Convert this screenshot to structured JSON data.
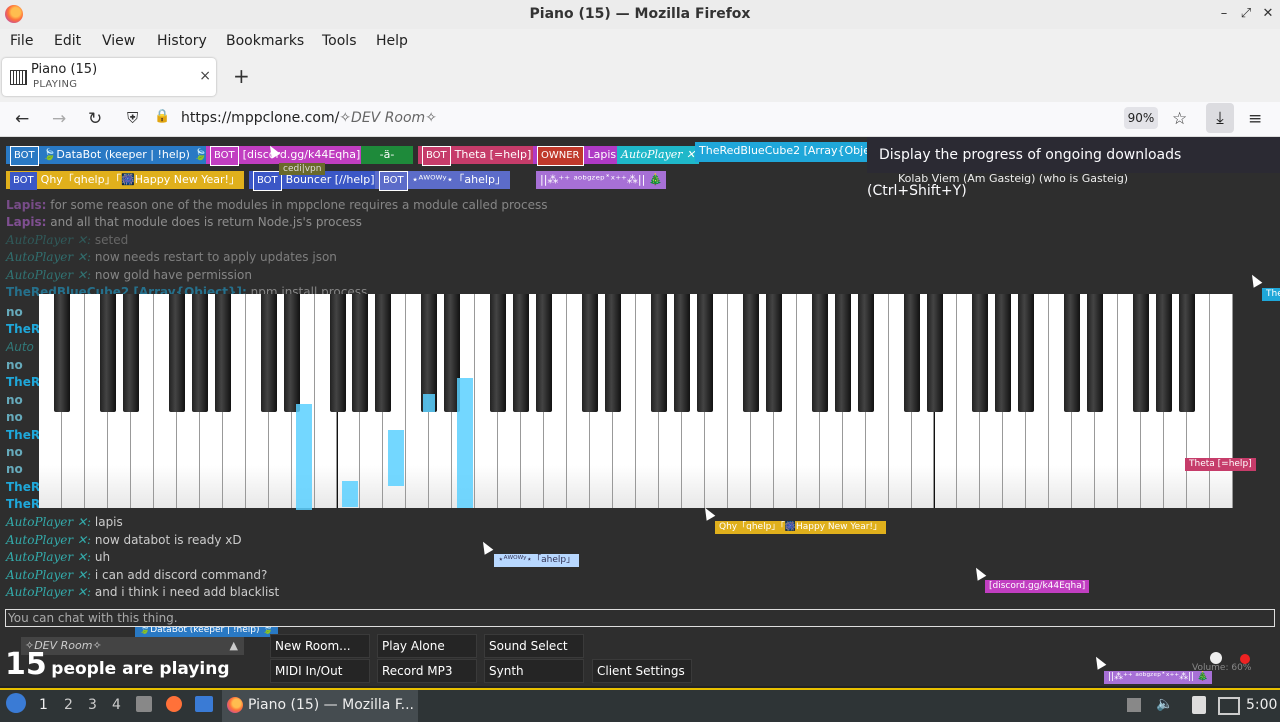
{
  "window": {
    "title": "Piano (15) — Mozilla Firefox",
    "minimize": "–",
    "maximize": "⤢",
    "close": "✕"
  },
  "menu": [
    "File",
    "Edit",
    "View",
    "History",
    "Bookmarks",
    "Tools",
    "Help"
  ],
  "tab": {
    "title": "Piano (15)",
    "status": "PLAYING",
    "close": "×",
    "new": "+"
  },
  "nav": {
    "url_host": "https://mppclone.com/",
    "url_path": "✧DEV Room✧",
    "zoom": "90%",
    "back": "←",
    "forward": "→",
    "reload": "↻",
    "star": "☆",
    "download": "⤓",
    "menu": "≡",
    "shield": "⛨",
    "lock": "🔒"
  },
  "tooltip": "Display the progress of ongoing downloads (Ctrl+Shift+Y)",
  "users_row1": [
    {
      "tag": "BOT",
      "name": "🍃DataBot (keeper | !help) 🍃",
      "bg": "#2979c4"
    },
    {
      "tag": "BOT",
      "name": "[discord.gg/k44Eqha]",
      "bg": "#c13ec1"
    },
    {
      "tag": "",
      "name": "-ä-",
      "bg": "#1e8a3a"
    },
    {
      "tag": "BOT",
      "name": "Theta [=help]",
      "bg": "#c63c6a"
    },
    {
      "tag": "OWNER",
      "name": "Lapis",
      "bg": "#b03ac6"
    },
    {
      "tag": "",
      "name": "AutoPlayer ✕",
      "bg": "#1fb8c9"
    },
    {
      "tag": "",
      "name": "TheRedBlueCube2 [Array{Obje",
      "bg": "#1fa7d9"
    }
  ],
  "users_row2": [
    {
      "tag": "BOT",
      "name": "Qhy「qhelp」「🎆Happy New Year!」",
      "bg": "#e0b01c"
    },
    {
      "tag": "BOT",
      "name": "Bouncer [//help]",
      "bg": "#3b57c6"
    },
    {
      "tag": "BOT",
      "name": "⋆ᴬᵂᴼᵂʸ⋆「ahelp」",
      "bg": "#5c6cc9"
    },
    {
      "tag": "",
      "name": "||⁂⁺⁺ ᵃᵒᵇᵍᶻᵉᵖ˟ˣ⁺⁺⁂|| 🎄",
      "bg": "#a770d6"
    }
  ],
  "extra_user": "Kolab Viem (Am Gasteig) (who is Gasteig)",
  "hover_label": "cedi|vpn",
  "chat_top": [
    {
      "name": "Lapis:",
      "text": "for some reason one of the modules in mppclone requires a module called process",
      "color": "#b565d3"
    },
    {
      "name": "Lapis:",
      "text": "and all that module does is return Node.js's process",
      "color": "#b565d3"
    },
    {
      "name": "AutoPlayer ✕:",
      "text": "seted",
      "color": "#3aa"
    },
    {
      "name": "AutoPlayer ✕:",
      "text": "now needs restart to apply updates json",
      "color": "#3aa"
    },
    {
      "name": "AutoPlayer ✕:",
      "text": "now gold have permission",
      "color": "#3aa"
    },
    {
      "name": "TheRedBlueCube2 [Array{Object}]:",
      "text": "npm install process",
      "color": "#1fa7d9"
    }
  ],
  "chat_bottom": [
    {
      "name": "AutoPlayer ✕:",
      "text": "lapis"
    },
    {
      "name": "AutoPlayer ✕:",
      "text": "now databot is ready xD"
    },
    {
      "name": "AutoPlayer ✕:",
      "text": "uh"
    },
    {
      "name": "AutoPlayer ✕:",
      "text": "i can add discord command?"
    },
    {
      "name": "AutoPlayer ✕:",
      "text": "and i think i need add blacklist"
    }
  ],
  "chat_side_labels": [
    "no",
    "TheR",
    "Auto",
    "no",
    "TheR",
    "no",
    "no",
    "TheR",
    "no",
    "no",
    "TheR",
    "TheR"
  ],
  "chat_placeholder": "You can chat with this thing.",
  "cursor_labels": [
    {
      "text": "Qhy「qhelp」「🎆Happy New Year!」",
      "bg": "#e0b01c"
    },
    {
      "text": "⋆ᴬᵂᴼᵂʸ⋆「ahelp」",
      "bg": "#5c6cc9"
    },
    {
      "text": "[discord.gg/k44Eqha]",
      "bg": "#c13ec1"
    },
    {
      "text": "Theta [=help]",
      "bg": "#c63c6a"
    },
    {
      "text": "🍃DataBot (keeper | !help) 🍃",
      "bg": "#2979c4"
    },
    {
      "text": "||⁂⁺⁺ ᵃᵒᵇᵍᶻᵉᵖ˟ˣ⁺⁺⁂|| 🎄",
      "bg": "#a770d6"
    },
    {
      "text": "The",
      "bg": "#1fa7d9"
    }
  ],
  "room": "✧DEV Room✧",
  "people": {
    "count": "15",
    "label": "people are playing"
  },
  "buttons": {
    "new_room": "New Room...",
    "play_alone": "Play Alone",
    "sound_select": "Sound Select",
    "midi": "MIDI In/Out",
    "record": "Record MP3",
    "synth": "Synth",
    "client_settings": "Client Settings"
  },
  "volume": "Volume: 60%",
  "taskbar": {
    "ws": [
      "1",
      "2",
      "3",
      "4"
    ],
    "window": "Piano (15) — Mozilla F...",
    "clock": "5:00"
  }
}
